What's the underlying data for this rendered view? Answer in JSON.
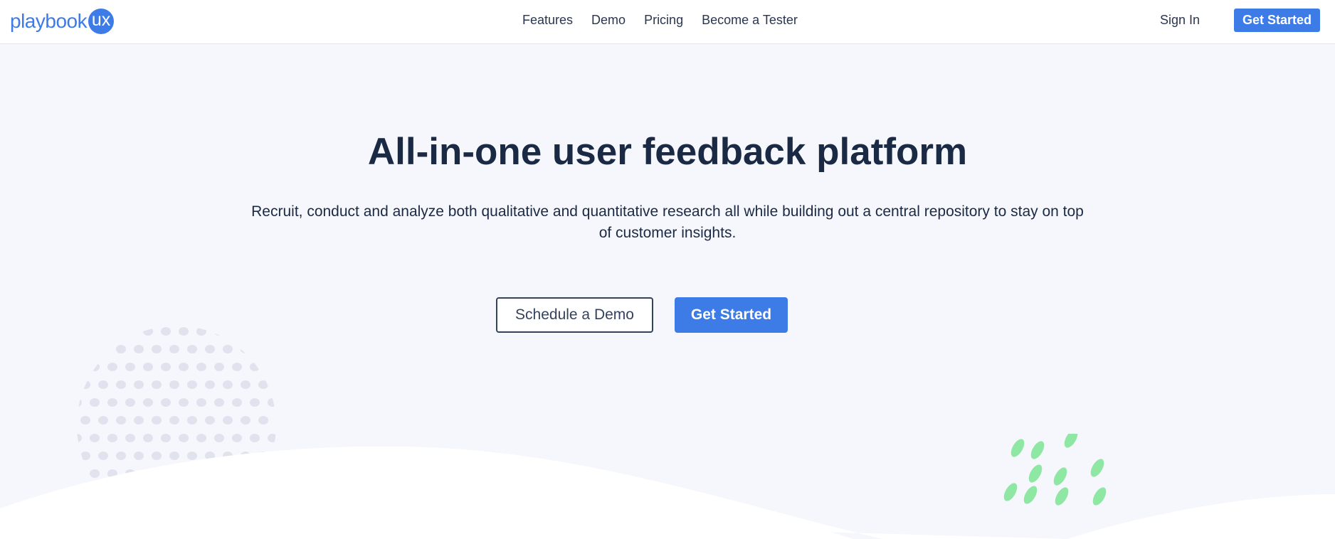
{
  "brand": {
    "name": "playbook",
    "badge": "ux",
    "color": "#3d7be6"
  },
  "nav": {
    "links": [
      "Features",
      "Demo",
      "Pricing",
      "Become a Tester"
    ],
    "sign_in": "Sign In",
    "cta": "Get Started"
  },
  "hero": {
    "title": "All-in-one user feedback platform",
    "subtitle": "Recruit, conduct and analyze both qualitative and quantitative research all while building out a central repository to stay on top of customer insights.",
    "secondary_cta": "Schedule a Demo",
    "primary_cta": "Get Started"
  },
  "colors": {
    "accent": "#3d7be6",
    "heading": "#1b2a44",
    "background": "#f6f7fc",
    "dot": "#e0e3ee",
    "leaf": "#8ee7a3"
  },
  "decorations": [
    "dot-pattern",
    "wave",
    "leaf-pattern"
  ]
}
